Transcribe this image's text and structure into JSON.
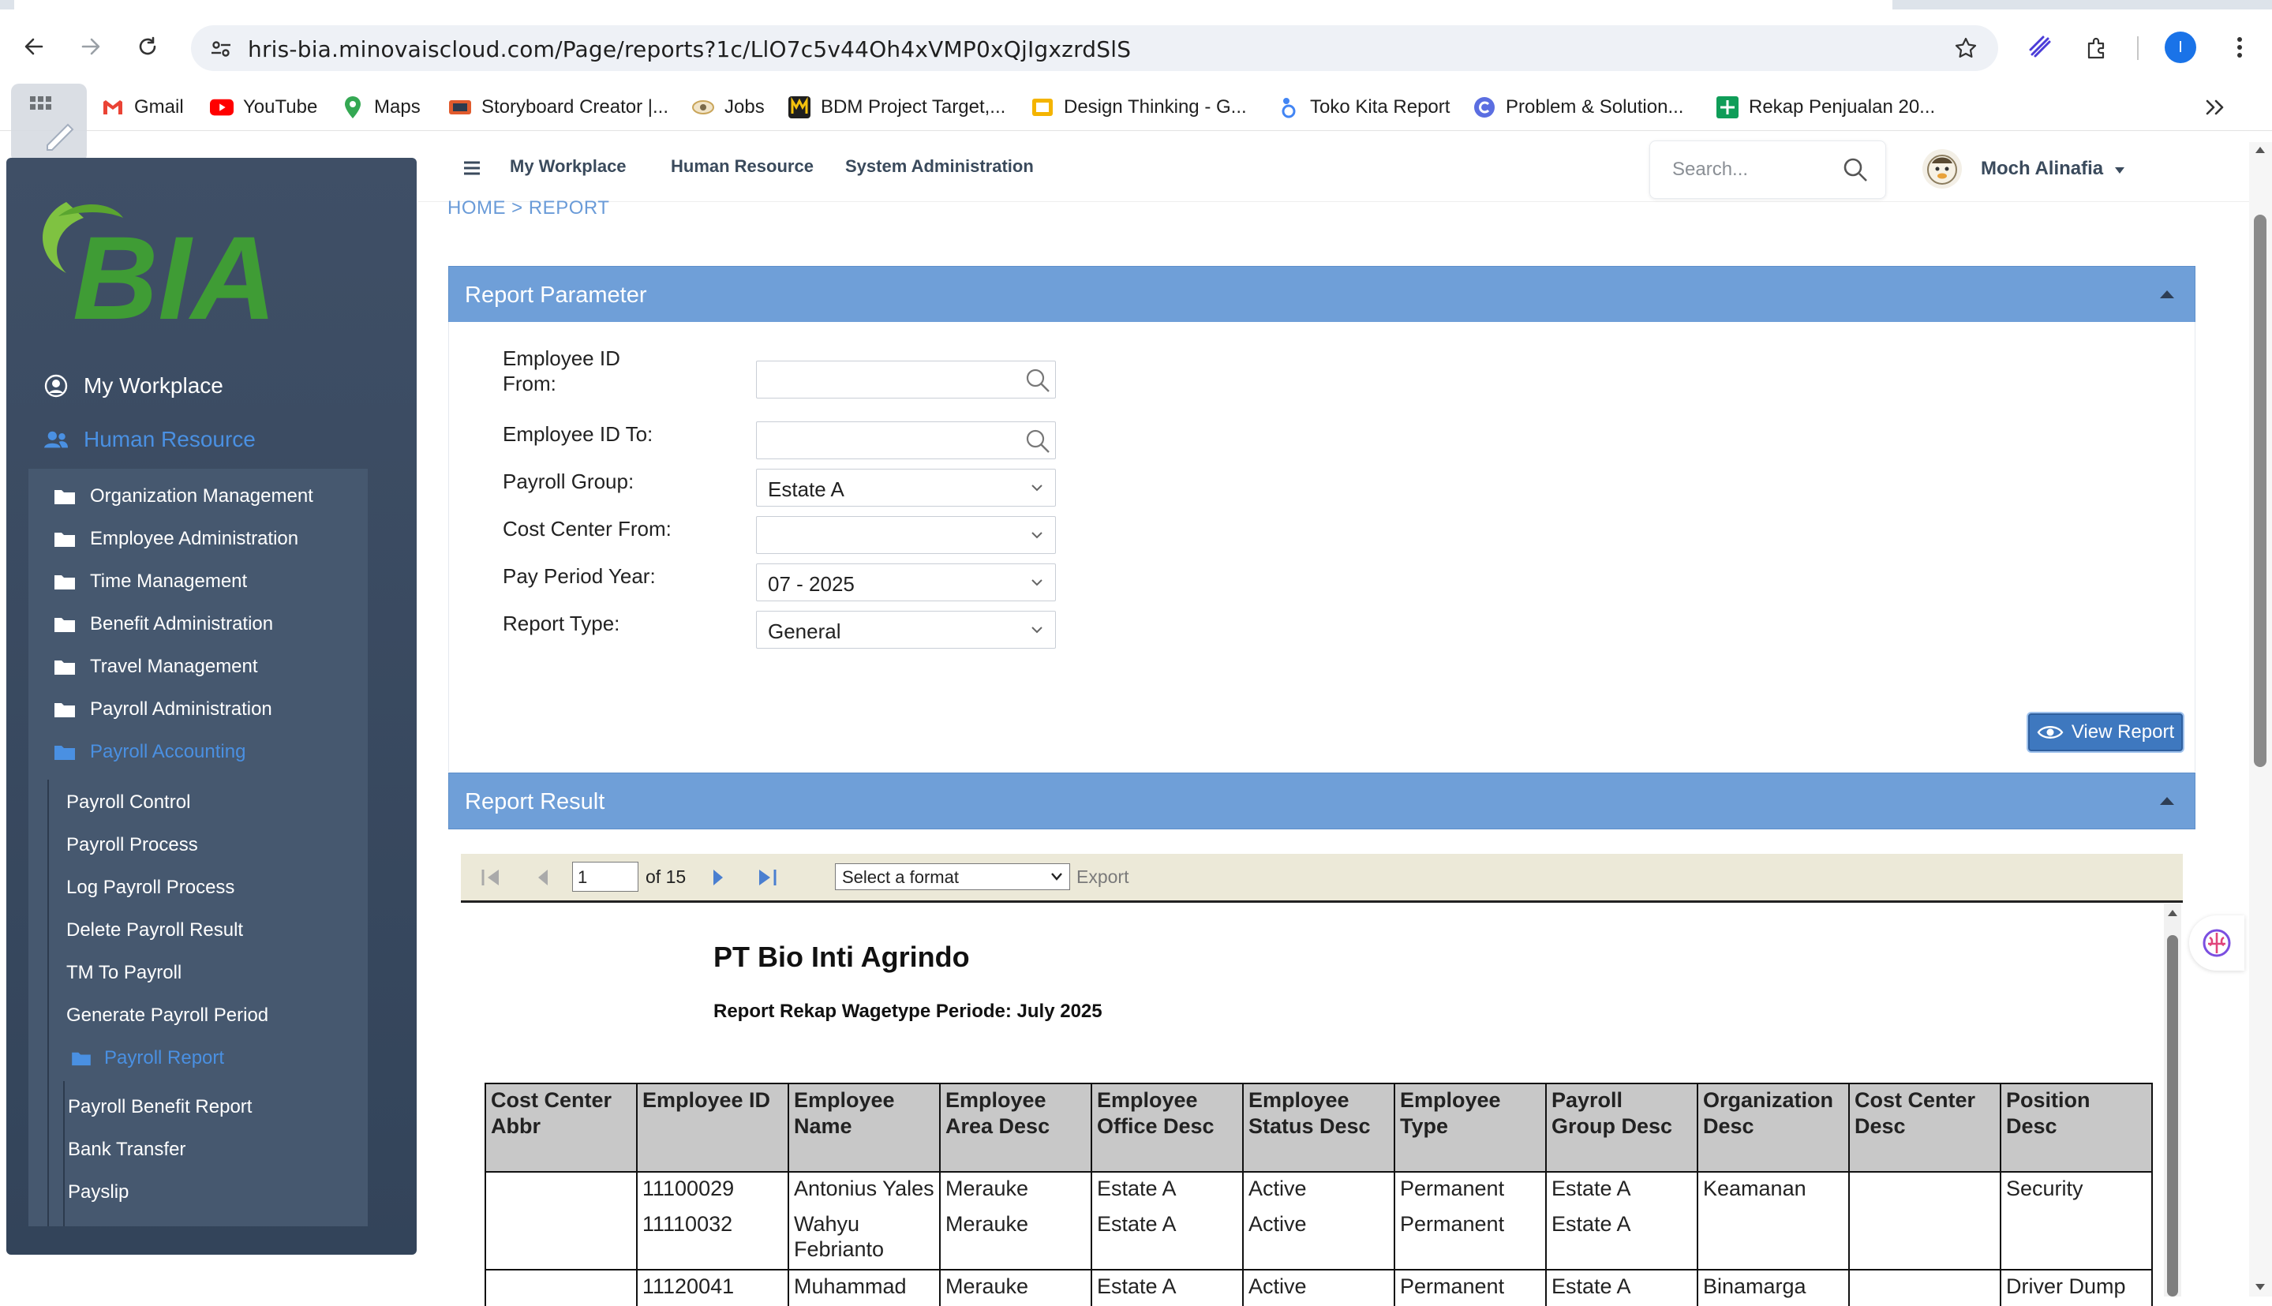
{
  "browser": {
    "url": "hris-bia.minovaiscloud.com/Page/reports?1c/LlO7c5v44Oh4xVMP0xQjIgxzrdSlS",
    "profile_initial": "I",
    "bookmarks": [
      {
        "label": "Gmail",
        "icon": "gmail-icon"
      },
      {
        "label": "YouTube",
        "icon": "youtube-icon"
      },
      {
        "label": "Maps",
        "icon": "maps-icon"
      },
      {
        "label": "Storyboard Creator |...",
        "icon": "storyboard-icon"
      },
      {
        "label": "Jobs",
        "icon": "jobs-icon"
      },
      {
        "label": "BDM Project Target,...",
        "icon": "bdm-icon"
      },
      {
        "label": "Design Thinking - G...",
        "icon": "slides-icon"
      },
      {
        "label": "Toko Kita Report",
        "icon": "looker-icon"
      },
      {
        "label": "Problem & Solution...",
        "icon": "canva-icon"
      },
      {
        "label": "Rekap Penjualan 20...",
        "icon": "sheets-icon"
      }
    ]
  },
  "nav": {
    "links": [
      "My Workplace",
      "Human Resource",
      "System Administration"
    ],
    "search_placeholder": "Search...",
    "user_name": "Moch Alinafia"
  },
  "sidebar": {
    "logo_text": "BIA",
    "top_items": [
      "My Workplace",
      "Human Resource"
    ],
    "modules": [
      "Organization Management",
      "Employee Administration",
      "Time Management",
      "Benefit Administration",
      "Travel Management",
      "Payroll Administration",
      "Payroll Accounting"
    ],
    "accounting_items": [
      "Payroll Control",
      "Payroll Process",
      "Log Payroll Process",
      "Delete Payroll Result",
      "TM To Payroll",
      "Generate Payroll Period"
    ],
    "report_folder": "Payroll Report",
    "report_items": [
      "Payroll Benefit Report",
      "Bank Transfer",
      "Payslip"
    ]
  },
  "breadcrumb": "HOME > REPORT",
  "parameter_panel": {
    "title": "Report Parameter",
    "fields": [
      {
        "label": "Employee ID From:",
        "value": ""
      },
      {
        "label": "Employee ID To:",
        "value": ""
      },
      {
        "label": "Payroll Group:",
        "value": "Estate A"
      },
      {
        "label": "Cost Center From:",
        "value": ""
      },
      {
        "label": "Pay Period Year:",
        "value": "07 - 2025"
      },
      {
        "label": "Report Type:",
        "value": "General"
      }
    ],
    "view_button": "View Report"
  },
  "result_panel": {
    "title": "Report Result",
    "page_current": "1",
    "page_total_text": "of 15",
    "format_placeholder": "Select a format",
    "export_label": "Export"
  },
  "report": {
    "company": "PT Bio Inti Agrindo",
    "subtitle": "Report Rekap Wagetype Periode: July 2025",
    "columns": [
      "Cost Center Abbr",
      "Employee ID",
      "Employee Name",
      "Employee Area Desc",
      "Employee Office Desc",
      "Employee Status Desc",
      "Employee Type",
      "Payroll Group Desc",
      "Organization Desc",
      "Cost Center Desc",
      "Position Desc"
    ],
    "rows": [
      [
        "",
        "11100029",
        "Antonius Yales",
        "Merauke",
        "Estate A",
        "Active",
        "Permanent",
        "Estate A",
        "Keamanan",
        "",
        "Security"
      ],
      [
        "",
        "11110032",
        "Wahyu Febrianto",
        "Merauke",
        "Estate A",
        "Active",
        "Permanent",
        "Estate A",
        "",
        "",
        ""
      ],
      [
        "",
        "11120041",
        "Muhammad",
        "Merauke",
        "Estate A",
        "Active",
        "Permanent",
        "Estate A",
        "Binamarga",
        "",
        "Driver Dump"
      ]
    ]
  }
}
